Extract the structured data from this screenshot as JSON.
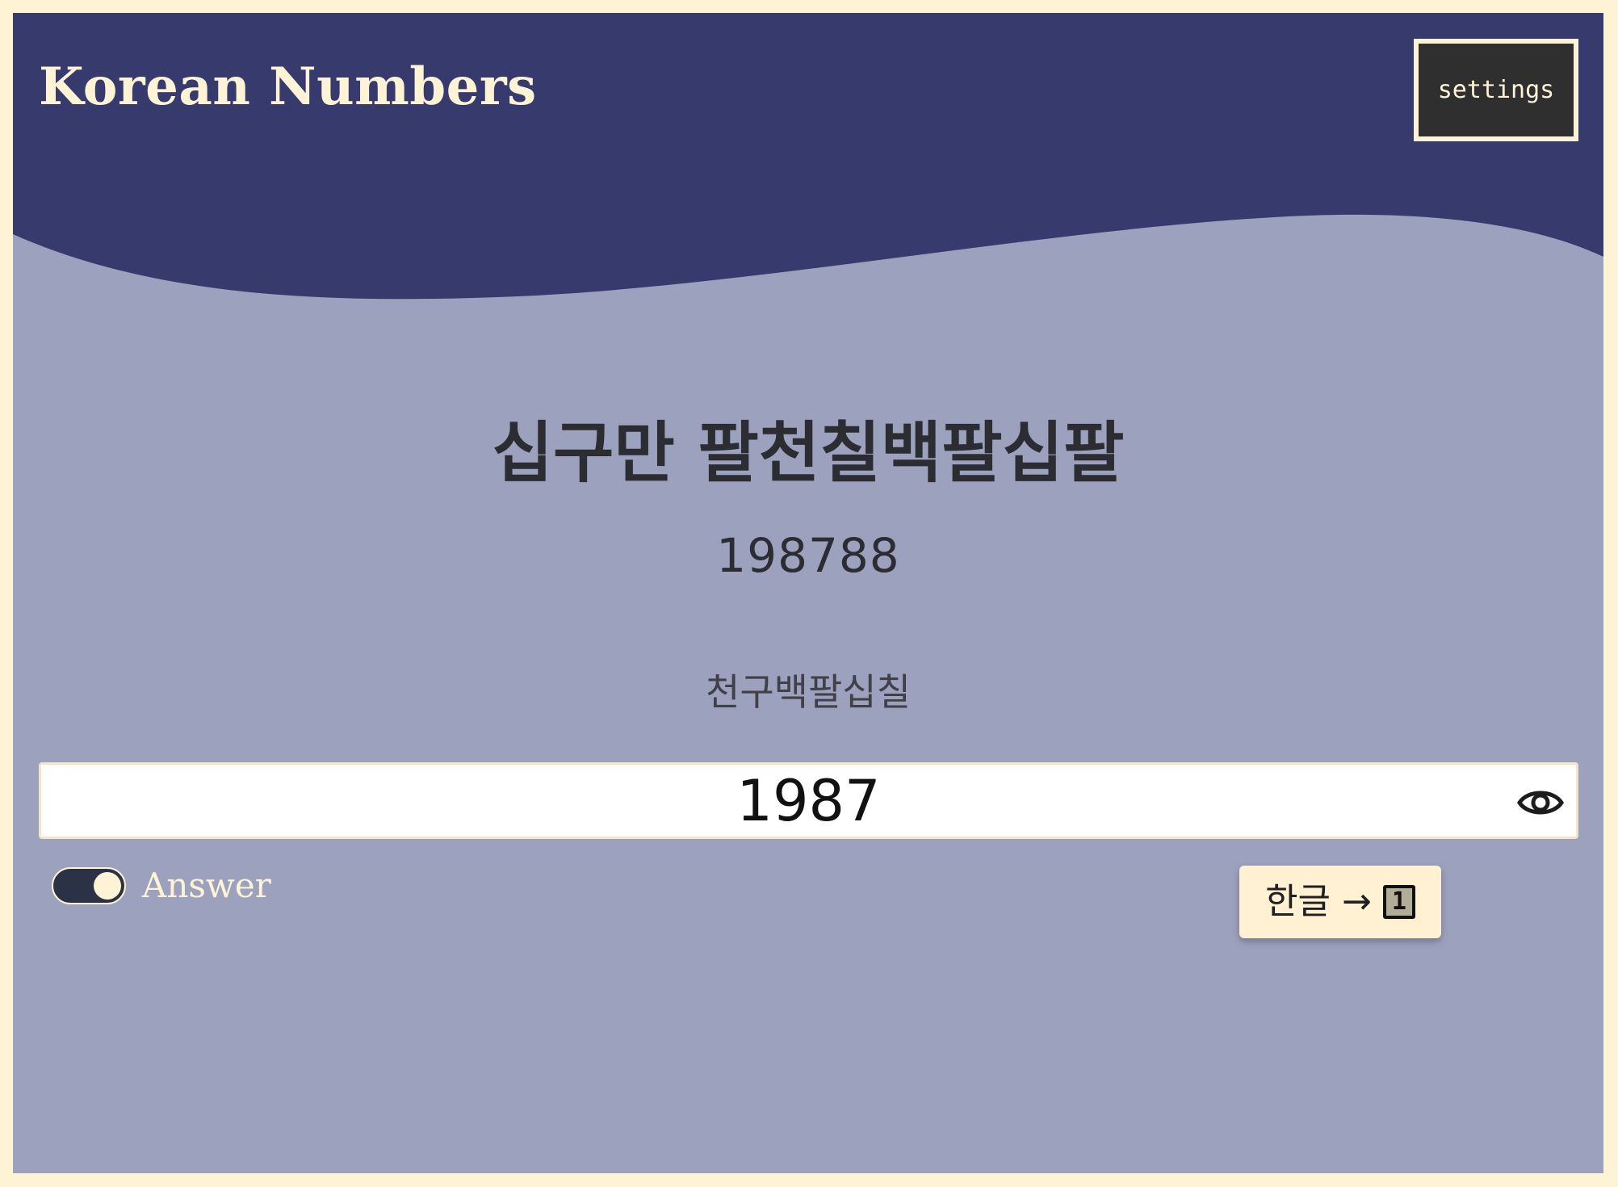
{
  "colors": {
    "page_border": "#fff3d6",
    "header": "#363a6d",
    "body": "#9ca1bd",
    "settings_bg": "#2f2f30",
    "cream": "#fff3d6",
    "text_dark": "#2c2d33"
  },
  "header": {
    "title": "Korean Numbers",
    "settings_label": "settings"
  },
  "question": {
    "korean": "십구만 팔천칠백팔십팔",
    "digits": "198788"
  },
  "hint": {
    "text": "천구백팔십칠"
  },
  "answer_field": {
    "value": "1987",
    "reveal_icon": "eye-icon"
  },
  "answer_toggle": {
    "label": "Answer",
    "on": true
  },
  "mode_button": {
    "from": "한글",
    "arrow": "→",
    "to": "1"
  }
}
